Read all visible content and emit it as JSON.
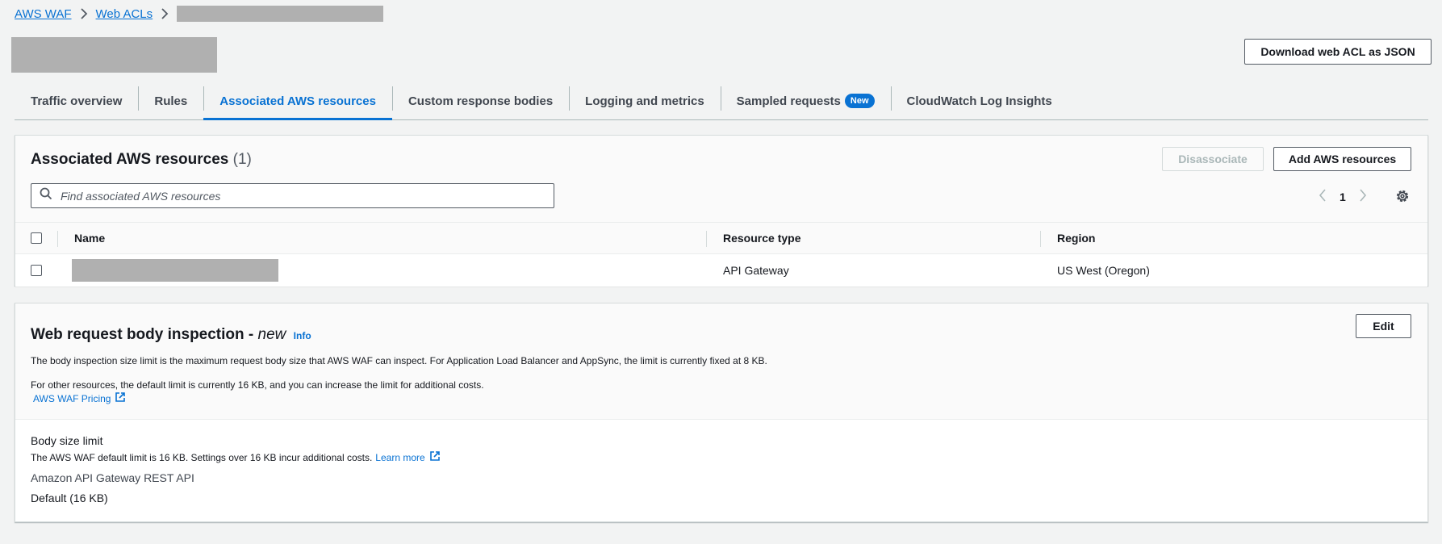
{
  "breadcrumb": {
    "item1": "AWS WAF",
    "item2": "Web ACLs"
  },
  "header": {
    "download_label": "Download web ACL as JSON"
  },
  "tabs": [
    {
      "label": "Traffic overview"
    },
    {
      "label": "Rules"
    },
    {
      "label": "Associated AWS resources"
    },
    {
      "label": "Custom response bodies"
    },
    {
      "label": "Logging and metrics"
    },
    {
      "label": "Sampled requests",
      "badge": "New"
    },
    {
      "label": "CloudWatch Log Insights"
    }
  ],
  "resources": {
    "title": "Associated AWS resources",
    "count": "(1)",
    "disassociate_label": "Disassociate",
    "add_label": "Add AWS resources",
    "search_placeholder": "Find associated AWS resources",
    "page": "1",
    "columns": {
      "name": "Name",
      "type": "Resource type",
      "region": "Region"
    },
    "rows": [
      {
        "type": "API Gateway",
        "region": "US West (Oregon)"
      }
    ]
  },
  "inspection": {
    "title": "Web request body inspection - ",
    "title_new": "new",
    "info": "Info",
    "edit_label": "Edit",
    "desc1": "The body inspection size limit is the maximum request body size that AWS WAF can inspect. For Application Load Balancer and AppSync, the limit is currently fixed at 8 KB.",
    "desc2": "For other resources, the default limit is currently 16 KB, and you can increase the limit for additional costs.",
    "pricing_link": "AWS WAF Pricing",
    "body_size_label": "Body size limit",
    "body_size_desc": "The AWS WAF default limit is 16 KB. Settings over 16 KB incur additional costs.",
    "learn_more": "Learn more",
    "api_label": "Amazon API Gateway REST API",
    "api_value": "Default (16 KB)"
  },
  "colors": {
    "link": "#0972d3",
    "border": "#d5dbdb",
    "background": "#f2f3f3"
  }
}
